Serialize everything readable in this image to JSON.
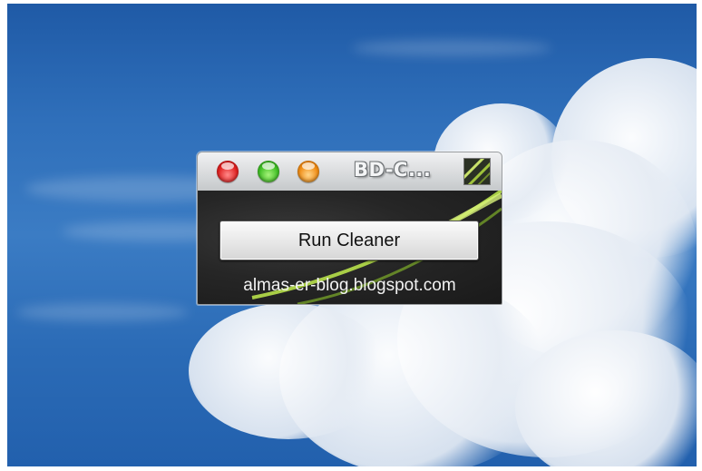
{
  "window": {
    "title": "BD-C...",
    "controls": {
      "close": "close-button",
      "maximize": "maximize-button",
      "minimize": "minimize-button"
    },
    "icon": "app-icon"
  },
  "content": {
    "run_label": "Run Cleaner",
    "link_text": "almas-er-blog.blogspot.com"
  },
  "colors": {
    "sky": "#2f6fba",
    "cloud": "#eef2f7",
    "titlebar": "#d9dbdd",
    "body": "#262626",
    "accent_swoosh": "#a8d63a",
    "close": "#e02020",
    "zoom": "#3fbf24",
    "minimize": "#f08c14"
  }
}
